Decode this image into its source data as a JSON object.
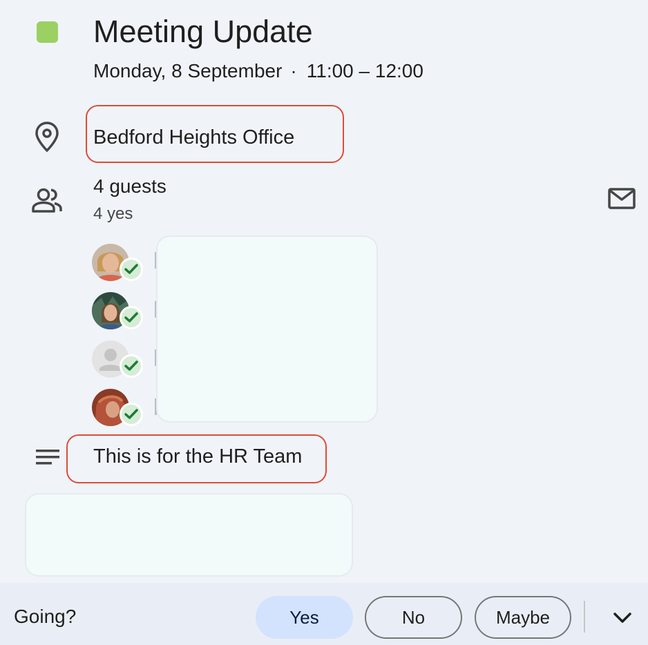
{
  "event": {
    "title": "Meeting Update",
    "date": "Monday, 8 September",
    "separator": "·",
    "time": "11:00 – 12:00",
    "color": "#9bd062"
  },
  "location": {
    "icon": "location-pin-icon",
    "text": "Bedford Heights Office"
  },
  "guests": {
    "icon": "people-icon",
    "count_label": "4 guests",
    "rsvp_summary": "4 yes",
    "email_icon": "mail-icon",
    "list": [
      {
        "avatar": "avatar-photo-1",
        "status": "accepted"
      },
      {
        "avatar": "avatar-photo-2",
        "status": "accepted"
      },
      {
        "avatar": "avatar-default",
        "status": "accepted"
      },
      {
        "avatar": "avatar-photo-3",
        "status": "accepted"
      }
    ]
  },
  "description": {
    "icon": "notes-icon",
    "text": "This is for the HR Team"
  },
  "footer": {
    "going_label": "Going?",
    "yes_label": "Yes",
    "no_label": "No",
    "maybe_label": "Maybe",
    "selected": "Yes",
    "more_icon": "chevron-down-icon"
  },
  "colors": {
    "background": "#f0f4f9",
    "highlight": "#e04b36",
    "selected_button": "#d3e3fd",
    "accept_check": "#1e7b34"
  }
}
